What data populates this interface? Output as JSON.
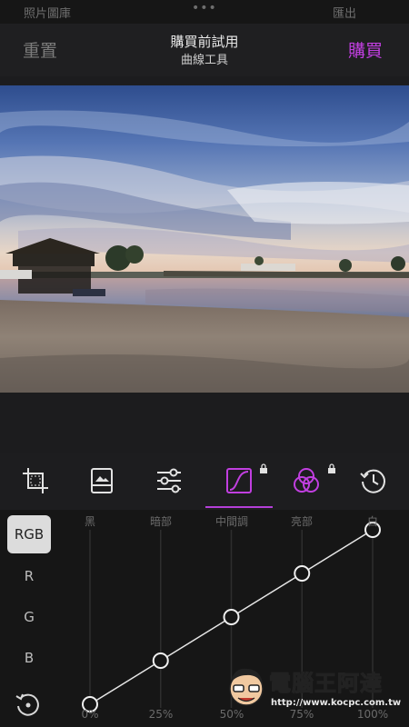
{
  "status_bar": {
    "left": "照片圖庫",
    "center": "•••",
    "right": "匯出"
  },
  "nav": {
    "reset_label": "重置",
    "title": "購買前試用",
    "subtitle": "曲線工具",
    "buy_label": "購買"
  },
  "toolbar": {
    "tools": [
      {
        "name": "crop-icon"
      },
      {
        "name": "image-icon"
      },
      {
        "name": "sliders-icon"
      },
      {
        "name": "curves-icon",
        "active": true,
        "locked": true
      },
      {
        "name": "color-circles-icon",
        "locked": true
      },
      {
        "name": "history-icon"
      }
    ]
  },
  "curves": {
    "channels": [
      "RGB",
      "R",
      "G",
      "B"
    ],
    "active_channel": "RGB",
    "tone_labels": [
      "黑",
      "暗部",
      "中間調",
      "亮部",
      "白"
    ],
    "percent_labels": [
      "0%",
      "25%",
      "50%",
      "75%",
      "100%"
    ],
    "points": [
      [
        0,
        0
      ],
      [
        25,
        25
      ],
      [
        50,
        50
      ],
      [
        75,
        75
      ],
      [
        100,
        100
      ]
    ]
  },
  "watermark": {
    "title": "電腦王阿達",
    "url": "http://www.kocpc.com.tw"
  },
  "colors": {
    "accent": "#c13fe0",
    "background": "#1c1c1e"
  }
}
